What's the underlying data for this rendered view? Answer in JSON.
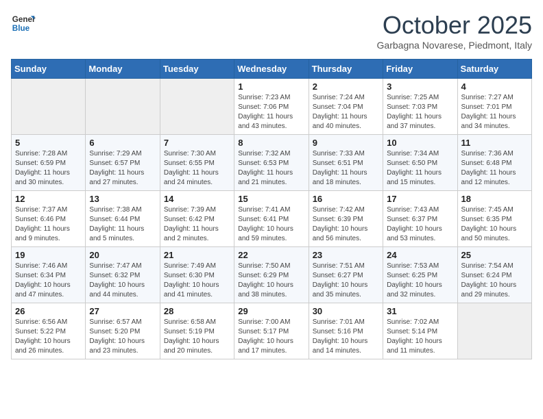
{
  "header": {
    "logo_line1": "General",
    "logo_line2": "Blue",
    "month": "October 2025",
    "location": "Garbagna Novarese, Piedmont, Italy"
  },
  "days_of_week": [
    "Sunday",
    "Monday",
    "Tuesday",
    "Wednesday",
    "Thursday",
    "Friday",
    "Saturday"
  ],
  "weeks": [
    [
      {
        "day": "",
        "info": ""
      },
      {
        "day": "",
        "info": ""
      },
      {
        "day": "",
        "info": ""
      },
      {
        "day": "1",
        "info": "Sunrise: 7:23 AM\nSunset: 7:06 PM\nDaylight: 11 hours\nand 43 minutes."
      },
      {
        "day": "2",
        "info": "Sunrise: 7:24 AM\nSunset: 7:04 PM\nDaylight: 11 hours\nand 40 minutes."
      },
      {
        "day": "3",
        "info": "Sunrise: 7:25 AM\nSunset: 7:03 PM\nDaylight: 11 hours\nand 37 minutes."
      },
      {
        "day": "4",
        "info": "Sunrise: 7:27 AM\nSunset: 7:01 PM\nDaylight: 11 hours\nand 34 minutes."
      }
    ],
    [
      {
        "day": "5",
        "info": "Sunrise: 7:28 AM\nSunset: 6:59 PM\nDaylight: 11 hours\nand 30 minutes."
      },
      {
        "day": "6",
        "info": "Sunrise: 7:29 AM\nSunset: 6:57 PM\nDaylight: 11 hours\nand 27 minutes."
      },
      {
        "day": "7",
        "info": "Sunrise: 7:30 AM\nSunset: 6:55 PM\nDaylight: 11 hours\nand 24 minutes."
      },
      {
        "day": "8",
        "info": "Sunrise: 7:32 AM\nSunset: 6:53 PM\nDaylight: 11 hours\nand 21 minutes."
      },
      {
        "day": "9",
        "info": "Sunrise: 7:33 AM\nSunset: 6:51 PM\nDaylight: 11 hours\nand 18 minutes."
      },
      {
        "day": "10",
        "info": "Sunrise: 7:34 AM\nSunset: 6:50 PM\nDaylight: 11 hours\nand 15 minutes."
      },
      {
        "day": "11",
        "info": "Sunrise: 7:36 AM\nSunset: 6:48 PM\nDaylight: 11 hours\nand 12 minutes."
      }
    ],
    [
      {
        "day": "12",
        "info": "Sunrise: 7:37 AM\nSunset: 6:46 PM\nDaylight: 11 hours\nand 9 minutes."
      },
      {
        "day": "13",
        "info": "Sunrise: 7:38 AM\nSunset: 6:44 PM\nDaylight: 11 hours\nand 5 minutes."
      },
      {
        "day": "14",
        "info": "Sunrise: 7:39 AM\nSunset: 6:42 PM\nDaylight: 11 hours\nand 2 minutes."
      },
      {
        "day": "15",
        "info": "Sunrise: 7:41 AM\nSunset: 6:41 PM\nDaylight: 10 hours\nand 59 minutes."
      },
      {
        "day": "16",
        "info": "Sunrise: 7:42 AM\nSunset: 6:39 PM\nDaylight: 10 hours\nand 56 minutes."
      },
      {
        "day": "17",
        "info": "Sunrise: 7:43 AM\nSunset: 6:37 PM\nDaylight: 10 hours\nand 53 minutes."
      },
      {
        "day": "18",
        "info": "Sunrise: 7:45 AM\nSunset: 6:35 PM\nDaylight: 10 hours\nand 50 minutes."
      }
    ],
    [
      {
        "day": "19",
        "info": "Sunrise: 7:46 AM\nSunset: 6:34 PM\nDaylight: 10 hours\nand 47 minutes."
      },
      {
        "day": "20",
        "info": "Sunrise: 7:47 AM\nSunset: 6:32 PM\nDaylight: 10 hours\nand 44 minutes."
      },
      {
        "day": "21",
        "info": "Sunrise: 7:49 AM\nSunset: 6:30 PM\nDaylight: 10 hours\nand 41 minutes."
      },
      {
        "day": "22",
        "info": "Sunrise: 7:50 AM\nSunset: 6:29 PM\nDaylight: 10 hours\nand 38 minutes."
      },
      {
        "day": "23",
        "info": "Sunrise: 7:51 AM\nSunset: 6:27 PM\nDaylight: 10 hours\nand 35 minutes."
      },
      {
        "day": "24",
        "info": "Sunrise: 7:53 AM\nSunset: 6:25 PM\nDaylight: 10 hours\nand 32 minutes."
      },
      {
        "day": "25",
        "info": "Sunrise: 7:54 AM\nSunset: 6:24 PM\nDaylight: 10 hours\nand 29 minutes."
      }
    ],
    [
      {
        "day": "26",
        "info": "Sunrise: 6:56 AM\nSunset: 5:22 PM\nDaylight: 10 hours\nand 26 minutes."
      },
      {
        "day": "27",
        "info": "Sunrise: 6:57 AM\nSunset: 5:20 PM\nDaylight: 10 hours\nand 23 minutes."
      },
      {
        "day": "28",
        "info": "Sunrise: 6:58 AM\nSunset: 5:19 PM\nDaylight: 10 hours\nand 20 minutes."
      },
      {
        "day": "29",
        "info": "Sunrise: 7:00 AM\nSunset: 5:17 PM\nDaylight: 10 hours\nand 17 minutes."
      },
      {
        "day": "30",
        "info": "Sunrise: 7:01 AM\nSunset: 5:16 PM\nDaylight: 10 hours\nand 14 minutes."
      },
      {
        "day": "31",
        "info": "Sunrise: 7:02 AM\nSunset: 5:14 PM\nDaylight: 10 hours\nand 11 minutes."
      },
      {
        "day": "",
        "info": ""
      }
    ]
  ]
}
